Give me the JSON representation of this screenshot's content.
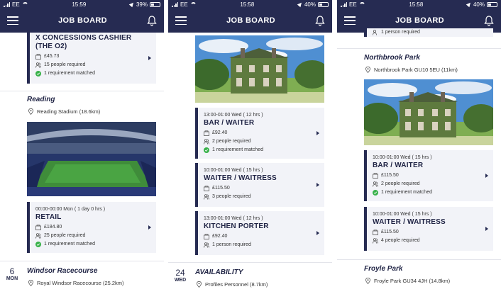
{
  "colors": {
    "navy": "#262b52",
    "card_bg": "#f2f3f8",
    "match_green": "#39b24a"
  },
  "screens": [
    {
      "status": {
        "carrier": "EE",
        "time": "15:59",
        "battery": "39%",
        "battery_level": 0.39
      },
      "header": {
        "title": "JOB BOARD"
      },
      "top_card": {
        "title": "X CONCESSIONS CASHIER (THE O2)",
        "pay": "£45.73",
        "people": "15 people required",
        "match": "1 requirement matched"
      },
      "venue1": {
        "name": "Reading",
        "location": "Reading Stadium (18.6km)"
      },
      "card1": {
        "time": "00:00-00:00 Mon ( 1 day 0 hrs )",
        "title": "RETAIL",
        "pay": "£184.80",
        "people": "25 people required",
        "match": "1 requirement matched"
      },
      "date": {
        "day": "6",
        "month": "MON"
      },
      "venue2": {
        "name": "Windsor Racecourse",
        "location": "Royal Windsor Racecourse (25.2km)"
      }
    },
    {
      "status": {
        "carrier": "EE",
        "time": "15:58",
        "battery": "40%",
        "battery_level": 0.4
      },
      "header": {
        "title": "JOB BOARD"
      },
      "card1": {
        "time": "13:00-01:00 Wed ( 12 hrs )",
        "title": "BAR / WAITER",
        "pay": "£92.40",
        "people": "2 people required",
        "match": "1 requirement matched"
      },
      "card2": {
        "time": "10:00-01:00 Wed ( 15 hrs )",
        "title": "WAITER / WAITRESS",
        "pay": "£115.50",
        "people": "3 people required"
      },
      "card3": {
        "time": "13:00-01:00 Wed ( 12 hrs )",
        "title": "KITCHEN PORTER",
        "pay": "£92.40",
        "people": "1 person required"
      },
      "date": {
        "day": "24",
        "month": "WED"
      },
      "venue2": {
        "name": "AVAILABILITY",
        "location": "Profiles Personnel (8.7km)"
      }
    },
    {
      "status": {
        "carrier": "EE",
        "time": "15:58",
        "battery": "40%",
        "battery_level": 0.4
      },
      "header": {
        "title": "JOB BOARD"
      },
      "top_cut": "1 person required",
      "venue1": {
        "name": "Northbrook Park",
        "location": "Northbrook Park GU10 5EU (11km)"
      },
      "card1": {
        "time": "10:00-01:00 Wed ( 15 hrs )",
        "title": "BAR / WAITER",
        "pay": "£115.50",
        "people": "2 people required",
        "match": "1 requirement matched"
      },
      "card2": {
        "time": "10:00-01:00 Wed ( 15 hrs )",
        "title": "WAITER / WAITRESS",
        "pay": "£115.50",
        "people": "4 people required"
      },
      "venue2": {
        "name": "Froyle Park",
        "location": "Froyle Park GU34 4JH (14.8km)"
      }
    }
  ]
}
